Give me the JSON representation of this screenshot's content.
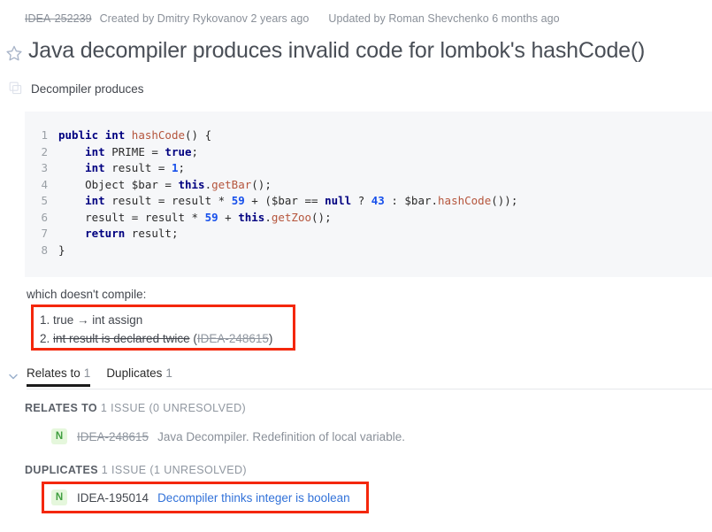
{
  "meta": {
    "issue_id": "IDEA-252239",
    "created": "Created by Dmitry Rykovanov 2 years ago",
    "updated": "Updated by Roman Shevchenko 6 months ago"
  },
  "title": "Java decompiler produces invalid code for lombok's hashCode()",
  "description": {
    "text": "Decompiler produces"
  },
  "code": {
    "lines": [
      {
        "n": "1",
        "tokens": [
          {
            "t": "public",
            "c": "kw"
          },
          {
            "t": " ",
            "c": "plain"
          },
          {
            "t": "int",
            "c": "kw"
          },
          {
            "t": " ",
            "c": "plain"
          },
          {
            "t": "hashCode",
            "c": "meth"
          },
          {
            "t": "() {",
            "c": "plain"
          }
        ]
      },
      {
        "n": "2",
        "tokens": [
          {
            "t": "    ",
            "c": "plain"
          },
          {
            "t": "int",
            "c": "kw"
          },
          {
            "t": " PRIME = ",
            "c": "plain"
          },
          {
            "t": "true",
            "c": "kw"
          },
          {
            "t": ";",
            "c": "plain"
          }
        ]
      },
      {
        "n": "3",
        "tokens": [
          {
            "t": "    ",
            "c": "plain"
          },
          {
            "t": "int",
            "c": "kw"
          },
          {
            "t": " result = ",
            "c": "plain"
          },
          {
            "t": "1",
            "c": "num"
          },
          {
            "t": ";",
            "c": "plain"
          }
        ]
      },
      {
        "n": "4",
        "tokens": [
          {
            "t": "    Object $bar = ",
            "c": "plain"
          },
          {
            "t": "this",
            "c": "kw"
          },
          {
            "t": ".",
            "c": "plain"
          },
          {
            "t": "getBar",
            "c": "meth"
          },
          {
            "t": "();",
            "c": "plain"
          }
        ]
      },
      {
        "n": "5",
        "tokens": [
          {
            "t": "    ",
            "c": "plain"
          },
          {
            "t": "int",
            "c": "kw"
          },
          {
            "t": " result = result * ",
            "c": "plain"
          },
          {
            "t": "59",
            "c": "num"
          },
          {
            "t": " + ($bar == ",
            "c": "plain"
          },
          {
            "t": "null",
            "c": "kw"
          },
          {
            "t": " ? ",
            "c": "plain"
          },
          {
            "t": "43",
            "c": "num"
          },
          {
            "t": " : $bar.",
            "c": "plain"
          },
          {
            "t": "hashCode",
            "c": "meth"
          },
          {
            "t": "());",
            "c": "plain"
          }
        ]
      },
      {
        "n": "6",
        "tokens": [
          {
            "t": "    result = result * ",
            "c": "plain"
          },
          {
            "t": "59",
            "c": "num"
          },
          {
            "t": " + ",
            "c": "plain"
          },
          {
            "t": "this",
            "c": "kw"
          },
          {
            "t": ".",
            "c": "plain"
          },
          {
            "t": "getZoo",
            "c": "meth"
          },
          {
            "t": "();",
            "c": "plain"
          }
        ]
      },
      {
        "n": "7",
        "tokens": [
          {
            "t": "    ",
            "c": "plain"
          },
          {
            "t": "return",
            "c": "kw"
          },
          {
            "t": " result;",
            "c": "plain"
          }
        ]
      },
      {
        "n": "8",
        "tokens": [
          {
            "t": "}",
            "c": "plain"
          }
        ]
      }
    ]
  },
  "compile_note": "which doesn't compile:",
  "compile_list": {
    "item1": "1. true → int assign",
    "item2_prefix": "2. ",
    "item2_strike": "int result is declared twice",
    "item2_paren_open": " (",
    "item2_link": "IDEA-248615",
    "item2_paren_close": ")"
  },
  "tabs": [
    {
      "label": "Relates to",
      "count": "1",
      "active": true
    },
    {
      "label": "Duplicates",
      "count": "1",
      "active": false
    }
  ],
  "sections": [
    {
      "head_bold": "RELATES TO",
      "head_rest": " 1 ISSUE (0 UNRESOLVED)",
      "issue": {
        "badge": "N",
        "key": "IDEA-248615",
        "summary": "Java Decompiler. Redefinition of local variable.",
        "resolved": true
      }
    },
    {
      "head_bold": "DUPLICATES",
      "head_rest": " 1 ISSUE (1 UNRESOLVED)",
      "issue": {
        "badge": "N",
        "key": "IDEA-195014",
        "summary": "Decompiler thinks integer is boolean",
        "resolved": false
      }
    }
  ],
  "icons": {
    "star": "star-outline-icon",
    "copy": "copy-icon",
    "chevron": "chevron-down-icon"
  },
  "colors": {
    "accent_link": "#3272d9",
    "annotation_red": "#f4270b",
    "badge_green_bg": "#e5f7dc",
    "badge_green_fg": "#3f9e3f",
    "code_bg": "#f6f7f9"
  }
}
